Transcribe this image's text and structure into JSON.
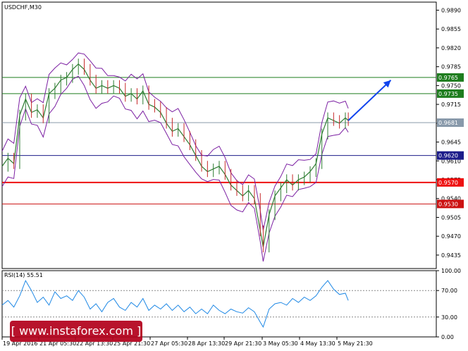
{
  "chart_data": [
    {
      "type": "line",
      "title": "USDCHF,M30",
      "ylim": [
        0.941,
        0.9905
      ],
      "grid": false,
      "y_ticks": [
        "0.9890",
        "0.9855",
        "0.9820",
        "0.9785",
        "0.9750",
        "0.9715",
        "0.9680",
        "0.9645",
        "0.9610",
        "0.9575",
        "0.9540",
        "0.9505",
        "0.9470",
        "0.9435"
      ],
      "x_ticks": [
        "19 Apr 2016",
        "21 Apr 05:30",
        "22 Apr 13:30",
        "25 Apr 21:30",
        "27 Apr 05:30",
        "28 Apr 13:30",
        "29 Apr 21:30",
        "3 May 05:30",
        "4 May 13:30",
        "5 May 21:30"
      ],
      "price_series": [
        {
          "bar": 0,
          "price": 0.96
        },
        {
          "bar": 4,
          "price": 0.9615
        },
        {
          "bar": 8,
          "price": 0.9605
        },
        {
          "bar": 12,
          "price": 0.9695
        },
        {
          "bar": 16,
          "price": 0.9725
        },
        {
          "bar": 20,
          "price": 0.97
        },
        {
          "bar": 24,
          "price": 0.9705
        },
        {
          "bar": 28,
          "price": 0.969
        },
        {
          "bar": 32,
          "price": 0.9735
        },
        {
          "bar": 36,
          "price": 0.9745
        },
        {
          "bar": 40,
          "price": 0.976
        },
        {
          "bar": 44,
          "price": 0.9765
        },
        {
          "bar": 48,
          "price": 0.978
        },
        {
          "bar": 52,
          "price": 0.979
        },
        {
          "bar": 56,
          "price": 0.978
        },
        {
          "bar": 60,
          "price": 0.976
        },
        {
          "bar": 64,
          "price": 0.9745
        },
        {
          "bar": 68,
          "price": 0.975
        },
        {
          "bar": 72,
          "price": 0.9745
        },
        {
          "bar": 76,
          "price": 0.975
        },
        {
          "bar": 80,
          "price": 0.9745
        },
        {
          "bar": 84,
          "price": 0.973
        },
        {
          "bar": 88,
          "price": 0.9735
        },
        {
          "bar": 92,
          "price": 0.9725
        },
        {
          "bar": 96,
          "price": 0.974
        },
        {
          "bar": 100,
          "price": 0.9715
        },
        {
          "bar": 104,
          "price": 0.971
        },
        {
          "bar": 108,
          "price": 0.97
        },
        {
          "bar": 112,
          "price": 0.968
        },
        {
          "bar": 116,
          "price": 0.9665
        },
        {
          "bar": 120,
          "price": 0.967
        },
        {
          "bar": 124,
          "price": 0.9655
        },
        {
          "bar": 128,
          "price": 0.964
        },
        {
          "bar": 132,
          "price": 0.962
        },
        {
          "bar": 136,
          "price": 0.96
        },
        {
          "bar": 140,
          "price": 0.959
        },
        {
          "bar": 144,
          "price": 0.9595
        },
        {
          "bar": 148,
          "price": 0.96
        },
        {
          "bar": 152,
          "price": 0.9585
        },
        {
          "bar": 156,
          "price": 0.9565
        },
        {
          "bar": 160,
          "price": 0.9555
        },
        {
          "bar": 164,
          "price": 0.9545
        },
        {
          "bar": 168,
          "price": 0.9555
        },
        {
          "bar": 172,
          "price": 0.954
        },
        {
          "bar": 176,
          "price": 0.948
        },
        {
          "bar": 178,
          "price": 0.945
        },
        {
          "bar": 182,
          "price": 0.951
        },
        {
          "bar": 186,
          "price": 0.9545
        },
        {
          "bar": 190,
          "price": 0.956
        },
        {
          "bar": 194,
          "price": 0.9575
        },
        {
          "bar": 198,
          "price": 0.9565
        },
        {
          "bar": 202,
          "price": 0.9575
        },
        {
          "bar": 206,
          "price": 0.958
        },
        {
          "bar": 210,
          "price": 0.959
        },
        {
          "bar": 214,
          "price": 0.9605
        },
        {
          "bar": 218,
          "price": 0.966
        },
        {
          "bar": 222,
          "price": 0.969
        },
        {
          "bar": 226,
          "price": 0.9685
        },
        {
          "bar": 230,
          "price": 0.968
        },
        {
          "bar": 234,
          "price": 0.969
        },
        {
          "bar": 236,
          "price": 0.9685
        }
      ],
      "bar_range": [
        0,
        296
      ],
      "bollinger_width": 0.0028,
      "levels": [
        {
          "price": 0.9765,
          "label": "0.9765",
          "color": "#1e7d1e"
        },
        {
          "price": 0.9735,
          "label": "0.9735",
          "color": "#1e7d1e"
        },
        {
          "price": 0.9681,
          "label": "0.9681",
          "color": "#8899aa"
        },
        {
          "price": 0.962,
          "label": "0.9620",
          "color": "#1c1c8a"
        },
        {
          "price": 0.957,
          "label": "0.9570",
          "color": "#ee1111"
        },
        {
          "price": 0.953,
          "label": "0.9530",
          "color": "#cc1111"
        }
      ],
      "forecast_arrow": {
        "from": {
          "bar": 236,
          "price": 0.9685
        },
        "to": {
          "bar": 265,
          "price": 0.976
        },
        "color": "#1144ee"
      },
      "colors": {
        "price": "#2e7d32",
        "bollinger": "#7b1fa2",
        "axis": "#000000"
      }
    },
    {
      "type": "line",
      "title": "RSI(14) 55.51",
      "ylim": [
        0,
        100
      ],
      "y_ticks": [
        "100.00",
        "70.00",
        "30.00",
        "0.00"
      ],
      "levels": [
        70,
        30
      ],
      "rsi_series": [
        {
          "bar": 0,
          "value": 48
        },
        {
          "bar": 4,
          "value": 55
        },
        {
          "bar": 8,
          "value": 45
        },
        {
          "bar": 12,
          "value": 62
        },
        {
          "bar": 16,
          "value": 85
        },
        {
          "bar": 20,
          "value": 70
        },
        {
          "bar": 24,
          "value": 52
        },
        {
          "bar": 28,
          "value": 60
        },
        {
          "bar": 32,
          "value": 48
        },
        {
          "bar": 36,
          "value": 68
        },
        {
          "bar": 40,
          "value": 58
        },
        {
          "bar": 44,
          "value": 62
        },
        {
          "bar": 48,
          "value": 55
        },
        {
          "bar": 52,
          "value": 70
        },
        {
          "bar": 56,
          "value": 60
        },
        {
          "bar": 60,
          "value": 42
        },
        {
          "bar": 64,
          "value": 50
        },
        {
          "bar": 68,
          "value": 38
        },
        {
          "bar": 72,
          "value": 52
        },
        {
          "bar": 76,
          "value": 58
        },
        {
          "bar": 80,
          "value": 45
        },
        {
          "bar": 84,
          "value": 40
        },
        {
          "bar": 88,
          "value": 52
        },
        {
          "bar": 92,
          "value": 45
        },
        {
          "bar": 96,
          "value": 58
        },
        {
          "bar": 100,
          "value": 40
        },
        {
          "bar": 104,
          "value": 48
        },
        {
          "bar": 108,
          "value": 42
        },
        {
          "bar": 112,
          "value": 50
        },
        {
          "bar": 116,
          "value": 40
        },
        {
          "bar": 120,
          "value": 48
        },
        {
          "bar": 124,
          "value": 38
        },
        {
          "bar": 128,
          "value": 45
        },
        {
          "bar": 132,
          "value": 35
        },
        {
          "bar": 136,
          "value": 42
        },
        {
          "bar": 140,
          "value": 35
        },
        {
          "bar": 144,
          "value": 48
        },
        {
          "bar": 148,
          "value": 40
        },
        {
          "bar": 152,
          "value": 35
        },
        {
          "bar": 156,
          "value": 42
        },
        {
          "bar": 160,
          "value": 38
        },
        {
          "bar": 164,
          "value": 36
        },
        {
          "bar": 168,
          "value": 44
        },
        {
          "bar": 172,
          "value": 38
        },
        {
          "bar": 176,
          "value": 22
        },
        {
          "bar": 178,
          "value": 15
        },
        {
          "bar": 182,
          "value": 42
        },
        {
          "bar": 186,
          "value": 50
        },
        {
          "bar": 190,
          "value": 52
        },
        {
          "bar": 194,
          "value": 48
        },
        {
          "bar": 198,
          "value": 58
        },
        {
          "bar": 202,
          "value": 52
        },
        {
          "bar": 206,
          "value": 60
        },
        {
          "bar": 210,
          "value": 55
        },
        {
          "bar": 214,
          "value": 62
        },
        {
          "bar": 218,
          "value": 75
        },
        {
          "bar": 222,
          "value": 85
        },
        {
          "bar": 226,
          "value": 72
        },
        {
          "bar": 230,
          "value": 64
        },
        {
          "bar": 234,
          "value": 66
        },
        {
          "bar": 236,
          "value": 55
        }
      ],
      "colors": {
        "rsi": "#1e88e5",
        "level": "#888888"
      }
    }
  ],
  "watermark": {
    "text": "[ www.instaforex.com ]",
    "color": "#b3001b"
  }
}
